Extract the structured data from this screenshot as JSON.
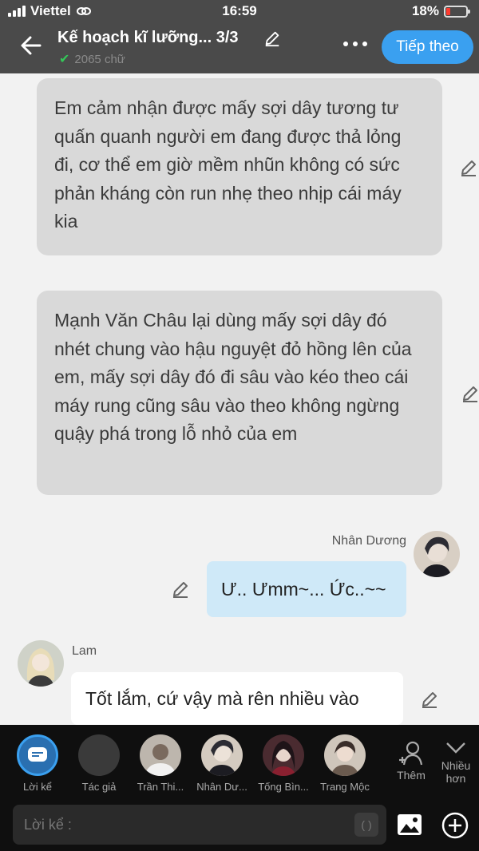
{
  "status_bar": {
    "carrier": "Viettel",
    "time": "16:59",
    "battery": "18%"
  },
  "header": {
    "title": "Kế hoạch kĩ lưỡng... 3/3",
    "word_count": "2065 chữ",
    "next_label": "Tiếp theo"
  },
  "messages": {
    "narration_1": "Em cảm nhận được mấy sợi dây tương tư quấn quanh người em đang được thả lỏng đi, cơ thể em giờ mềm nhũn không có sức phản kháng còn run nhẹ theo nhịp cái máy kia",
    "narration_2": "Mạnh Văn Châu lại dùng mấy sợi dây đó nhét chung vào hậu nguyệt đỏ hồng lên của em, mấy sợi dây đó đi sâu vào kéo theo cái máy rung cũng sâu vào theo không ngừng quậy phá trong lỗ nhỏ của em",
    "me_name": "Nhân Dương",
    "me_text": "Ư.. Ưmm~... Ức..~~",
    "other_name": "Lam",
    "other_text": "Tốt lắm, cứ vậy mà rên nhiều vào"
  },
  "characters": [
    {
      "label": "Lời kể"
    },
    {
      "label": "Tác giả"
    },
    {
      "label": "Trần Thi..."
    },
    {
      "label": "Nhân Dư..."
    },
    {
      "label": "Tống Bìn..."
    },
    {
      "label": "Trang Mộc"
    }
  ],
  "actions": {
    "add_label": "Thêm",
    "more_label": "Nhiều hơn"
  },
  "input": {
    "placeholder": "Lời kể :",
    "bracket": "( )"
  },
  "colors": {
    "accent": "#3aa0f0",
    "my_bubble": "#cfe9f8",
    "narration_bubble": "#d9d9d9",
    "header_bg": "#4a4a4a",
    "bottom_bg": "#0f0f0f"
  }
}
